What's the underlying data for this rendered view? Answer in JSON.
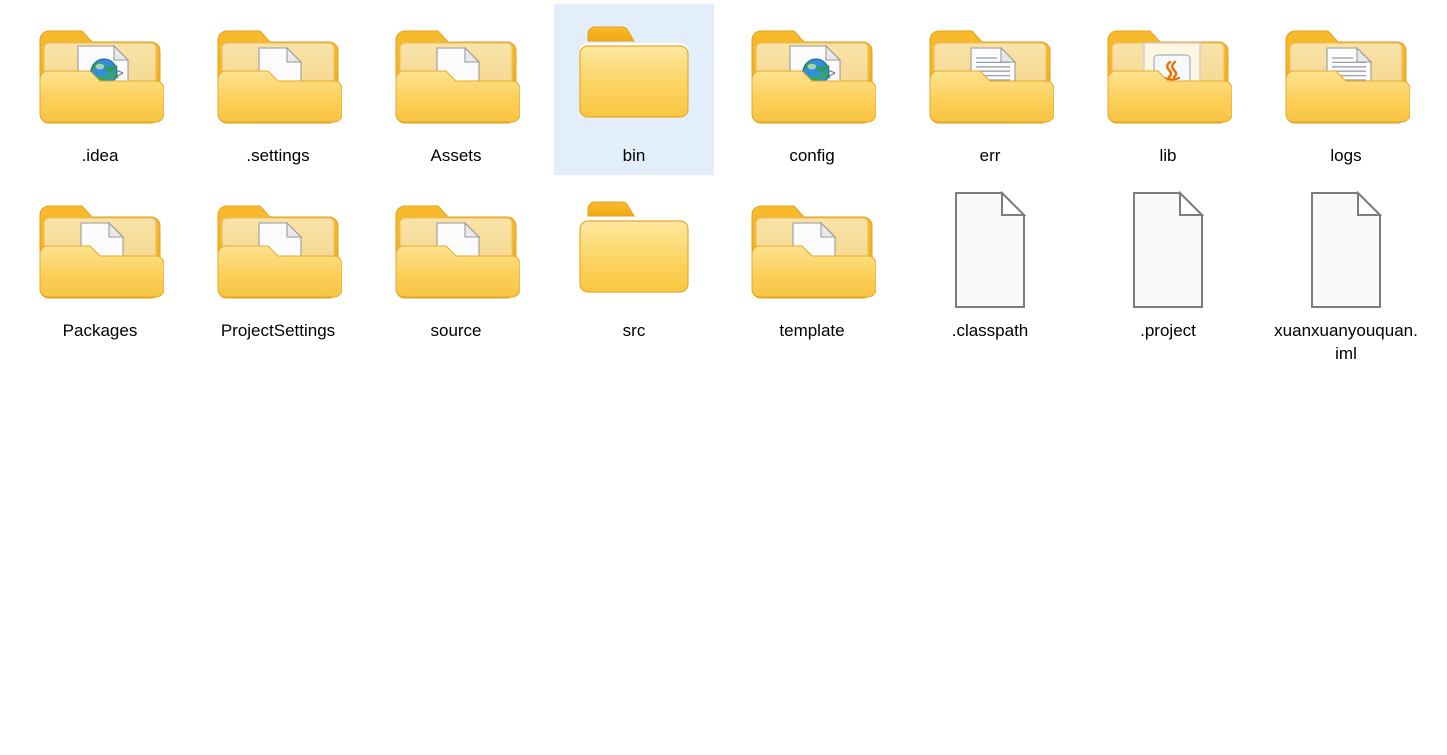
{
  "view": {
    "name": "file-explorer-icon-grid",
    "columns": 8,
    "background_color": "#ffffff",
    "selection_color": "#e2effb",
    "label_color": "#000000"
  },
  "palette": {
    "folder_tab": "#f5b21c",
    "folder_tab_dark": "#e8a117",
    "folder_front_top": "#fee08a",
    "folder_front_bottom": "#fbc council",
    "folder_front": "#fcd462",
    "folder_back": "#f7dfa0",
    "folder_outline": "#e8a425",
    "document_fill": "#fdfdfd",
    "document_outline": "#8a8a8a",
    "java_orange": "#e76f00",
    "globe_green": "#2fa84a",
    "globe_blue": "#1f6fc4"
  },
  "items": [
    {
      "label": ".idea",
      "type": "folder",
      "icon": "folder-html-document-icon",
      "selected": false
    },
    {
      "label": ".settings",
      "type": "folder",
      "icon": "folder-blank-document-icon",
      "selected": false
    },
    {
      "label": "Assets",
      "type": "folder",
      "icon": "folder-blank-document-icon",
      "selected": false
    },
    {
      "label": "bin",
      "type": "folder",
      "icon": "folder-empty-icon",
      "selected": true
    },
    {
      "label": "config",
      "type": "folder",
      "icon": "folder-html-document-icon",
      "selected": false
    },
    {
      "label": "err",
      "type": "folder",
      "icon": "folder-text-document-icon",
      "selected": false
    },
    {
      "label": "lib",
      "type": "folder",
      "icon": "folder-java-archive-icon",
      "selected": false
    },
    {
      "label": "logs",
      "type": "folder",
      "icon": "folder-text-document-icon",
      "selected": false
    },
    {
      "label": "Packages",
      "type": "folder",
      "icon": "folder-blank-document-icon",
      "selected": false
    },
    {
      "label": "ProjectSettings",
      "type": "folder",
      "icon": "folder-blank-document-icon",
      "selected": false
    },
    {
      "label": "source",
      "type": "folder",
      "icon": "folder-blank-document-icon",
      "selected": false
    },
    {
      "label": "src",
      "type": "folder",
      "icon": "folder-empty-icon",
      "selected": false
    },
    {
      "label": "template",
      "type": "folder",
      "icon": "folder-blank-document-icon",
      "selected": false
    },
    {
      "label": ".classpath",
      "type": "file",
      "icon": "plain-document-icon",
      "selected": false
    },
    {
      "label": ".project",
      "type": "file",
      "icon": "plain-document-icon",
      "selected": false
    },
    {
      "label": "xuanxuanyouquan.iml",
      "type": "file",
      "icon": "plain-document-icon",
      "selected": false
    }
  ]
}
